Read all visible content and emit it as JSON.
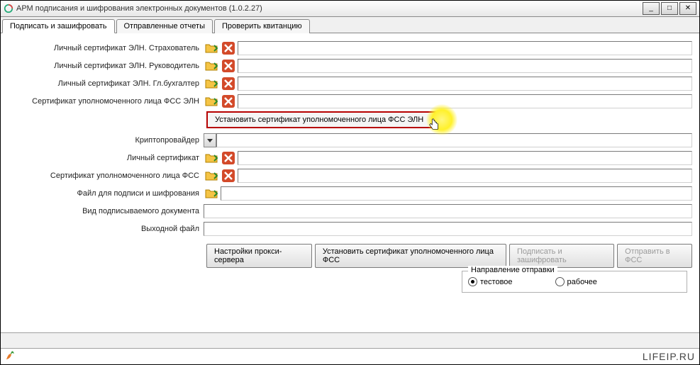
{
  "window": {
    "title": "АРМ подписания и шифрования электронных документов (1.0.2.27)"
  },
  "tabs": [
    {
      "label": "Подписать и зашифровать",
      "active": true
    },
    {
      "label": "Отправленные отчеты",
      "active": false
    },
    {
      "label": "Проверить квитанцию",
      "active": false
    }
  ],
  "fields": {
    "insurer_cert": "Личный сертификат ЭЛН. Страхователь",
    "leader_cert": "Личный сертификат ЭЛН. Руководитель",
    "accountant_cert": "Личный сертификат ЭЛН. Гл.бухгалтер",
    "fss_eln_cert": "Сертификат уполномоченного лица ФСС ЭЛН",
    "install_fss_eln": "Установить сертификат уполномоченного лица ФСС ЭЛН",
    "crypto_provider": "Криптопровайдер",
    "personal_cert": "Личный сертификат",
    "fss_cert": "Сертификат уполномоченного лица ФСС",
    "file_to_sign": "Файл для подписи и шифрования",
    "doc_type": "Вид подписываемого документа",
    "output_file": "Выходной файл"
  },
  "buttons": {
    "proxy": "Настройки прокси-сервера",
    "install_fss": "Установить сертификат уполномоченного лица ФСС",
    "sign": "Подписать и зашифровать",
    "send": "Отправить в ФСС"
  },
  "radio_group": {
    "title": "Направление отправки",
    "opt_test": "тестовое",
    "opt_work": "рабочее"
  },
  "watermark": "LIFEIP.RU"
}
